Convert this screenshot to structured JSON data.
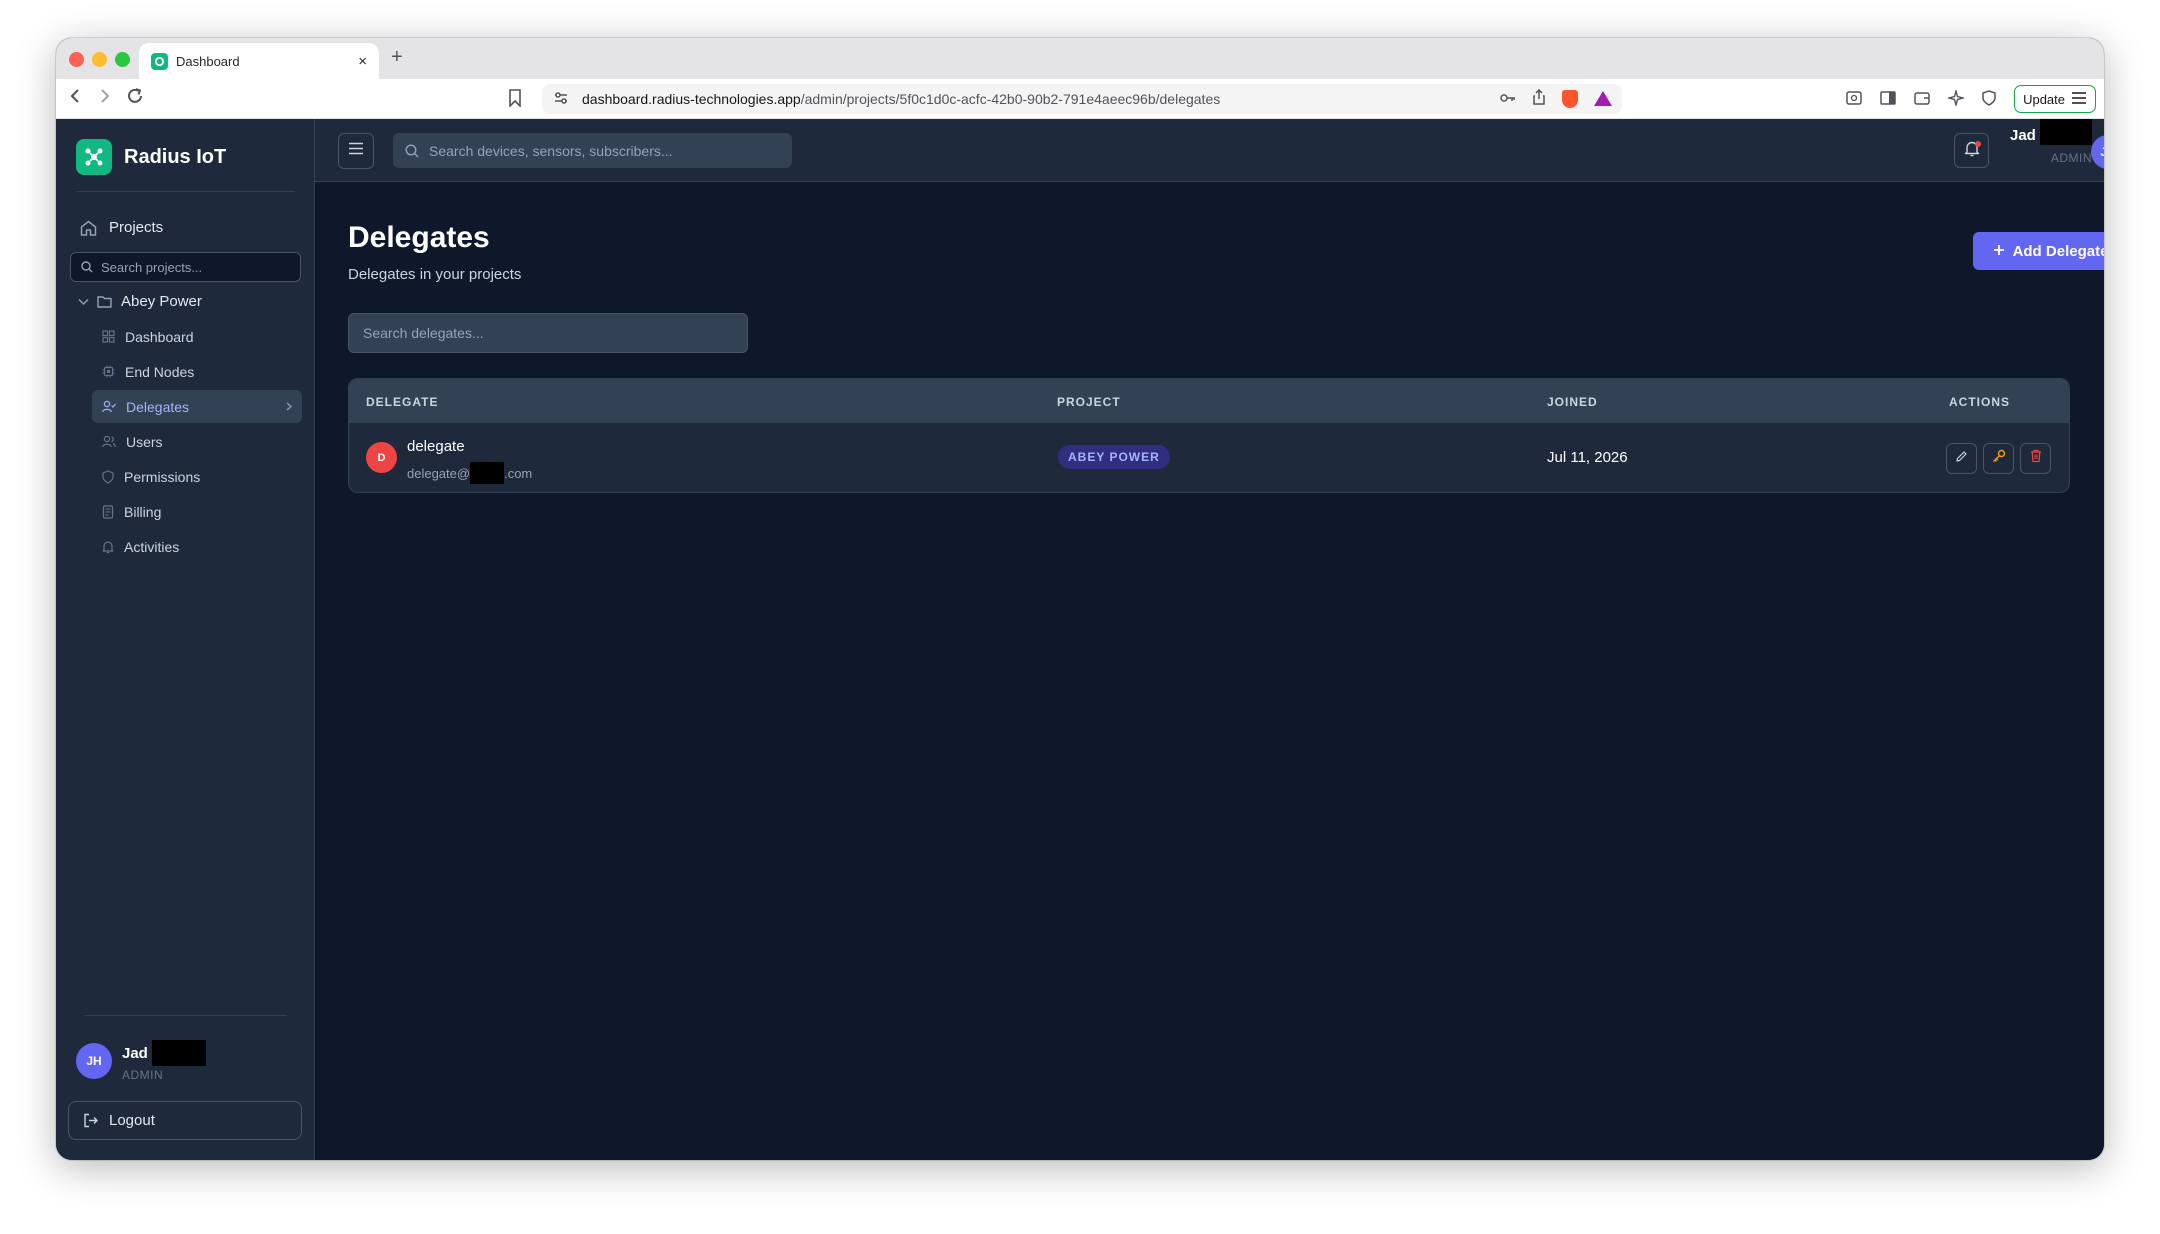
{
  "browser": {
    "tab_title": "Dashboard",
    "tab_close": "×",
    "new_tab": "+",
    "url_domain": "dashboard.radius-technologies.app",
    "url_path": "/admin/projects/5f0c1d0c-acfc-42b0-90b2-791e4aeec96b/delegates",
    "update_label": "Update"
  },
  "sidebar": {
    "brand": "Radius IoT",
    "projects_label": "Projects",
    "project_search_placeholder": "Search projects...",
    "project_name": "Abey Power",
    "items": [
      {
        "label": "Dashboard",
        "icon": "grid-icon"
      },
      {
        "label": "End Nodes",
        "icon": "cpu-icon"
      },
      {
        "label": "Delegates",
        "icon": "user-check-icon",
        "active": true
      },
      {
        "label": "Users",
        "icon": "users-icon"
      },
      {
        "label": "Permissions",
        "icon": "shield-icon"
      },
      {
        "label": "Billing",
        "icon": "receipt-icon"
      },
      {
        "label": "Activities",
        "icon": "bell-icon"
      }
    ],
    "user": {
      "initials": "JH",
      "name": "Jad",
      "role": "ADMIN"
    },
    "logout_label": "Logout"
  },
  "topbar": {
    "search_placeholder": "Search devices, sensors, subscribers...",
    "user": {
      "initials": "JH",
      "name": "Jad",
      "role": "ADMIN"
    }
  },
  "page": {
    "title": "Delegates",
    "subtitle": "Delegates in your projects",
    "add_button_label": "Add Delegate",
    "search_placeholder": "Search delegates..."
  },
  "table": {
    "columns": {
      "delegate": "DELEGATE",
      "project": "PROJECT",
      "joined": "JOINED",
      "actions": "ACTIONS"
    },
    "rows": [
      {
        "initial": "D",
        "name": "delegate",
        "email_prefix": "delegate@",
        "email_suffix": ".com",
        "project": "ABEY POWER",
        "joined": "Jul 11, 2026"
      }
    ]
  },
  "colors": {
    "accent": "#6366f1",
    "brand": "#10b981",
    "danger": "#ef4444",
    "warning": "#f59e0b",
    "background": "#0f172a",
    "panel": "#1e293b"
  }
}
